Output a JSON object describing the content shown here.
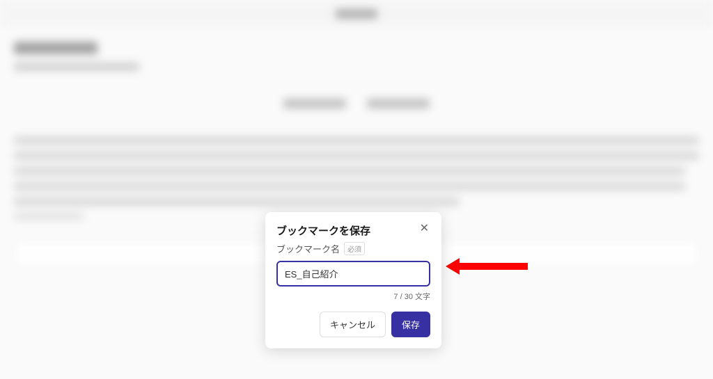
{
  "modal": {
    "title": "ブックマークを保存",
    "fieldLabel": "ブックマーク名",
    "requiredBadge": "必須",
    "inputValue": "ES_自己紹介",
    "charCount": "7 / 30 文字",
    "cancelLabel": "キャンセル",
    "saveLabel": "保存"
  }
}
